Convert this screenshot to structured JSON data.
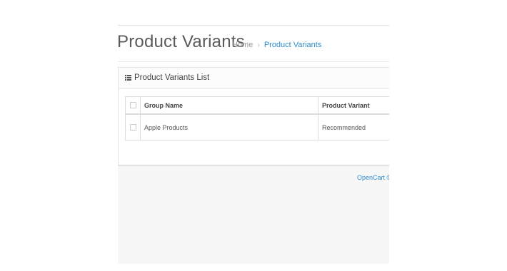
{
  "header": {
    "title": "Product Variants",
    "breadcrumb": {
      "home": "Home",
      "separator": "›",
      "current": "Product Variants"
    }
  },
  "panel": {
    "icon": "list-icon",
    "title": "Product Variants List"
  },
  "table": {
    "columns": [
      "Group Name",
      "Product Variant"
    ],
    "rows": [
      {
        "group_name": "Apple Products",
        "product_variant": "Recommended",
        "selected": false
      }
    ]
  },
  "footer": {
    "text": "OpenCart ©"
  },
  "colors": {
    "link": "#2e8ece",
    "title": "#5a5a5a",
    "background": "#f7f7f7"
  }
}
